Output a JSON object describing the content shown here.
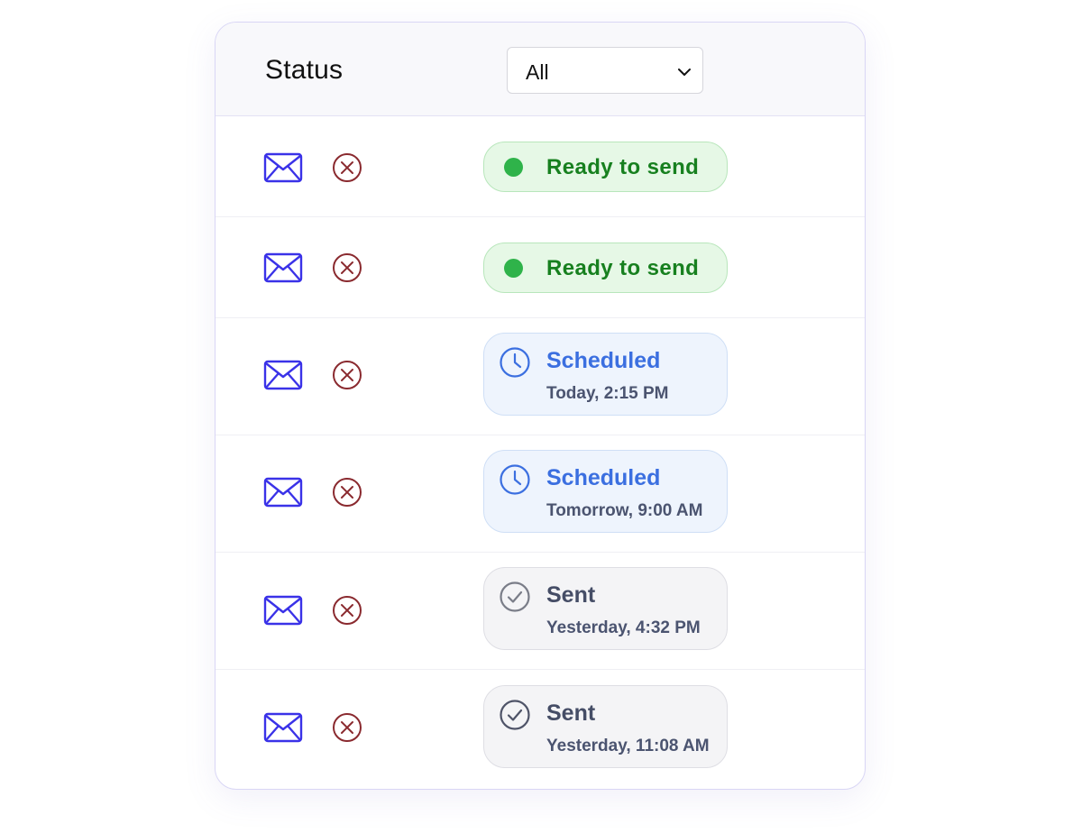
{
  "header": {
    "title": "Status",
    "filter": {
      "value": "All"
    }
  },
  "rows": [
    {
      "status": "Ready to send"
    },
    {
      "status": "Ready to send"
    },
    {
      "status": "Scheduled",
      "time": "Today, 2:15 PM"
    },
    {
      "status": "Scheduled",
      "time": "Tomorrow, 9:00 AM"
    },
    {
      "status": "Sent",
      "time": "Yesterday, 4:32 PM"
    },
    {
      "status": "Sent",
      "time": "Yesterday, 11:08 AM"
    }
  ],
  "icons": {
    "mail": "envelope-icon",
    "cancel": "cancel-circle-icon",
    "scheduled": "clock-icon",
    "sent": "check-circle-icon",
    "ready": "green-dot-icon",
    "dropdown": "chevron-down-icon"
  },
  "colors": {
    "mail_icon": "#3a32e8",
    "cancel_icon": "#8a2a2f",
    "ready_text": "#17801f",
    "ready_dot": "#2fb34a",
    "scheduled_text": "#3b6fe0",
    "sent_text": "#454d66"
  }
}
